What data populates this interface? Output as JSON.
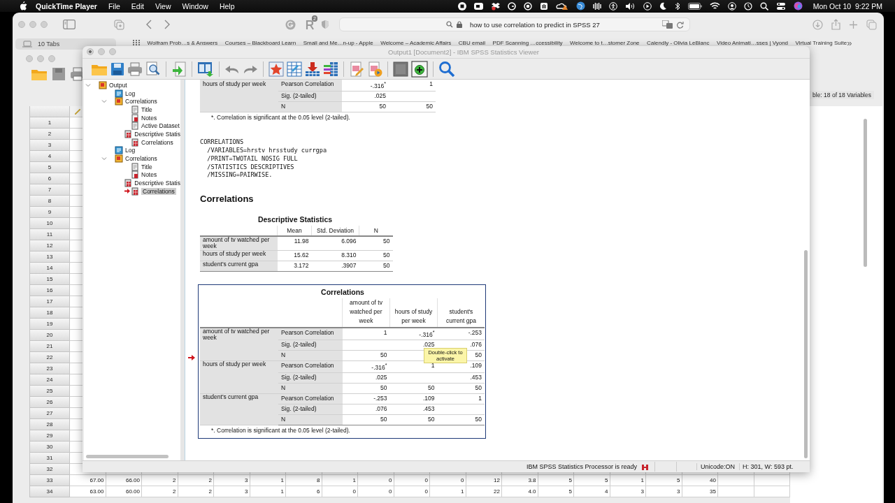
{
  "menubar": {
    "app": "QuickTime Player",
    "menus": [
      "File",
      "Edit",
      "View",
      "Window",
      "Help"
    ],
    "clock": "Mon Oct 10  9:22 PM"
  },
  "browser": {
    "tab_count": "10 Tabs",
    "extension_badge": "2",
    "address": "how to use correlation to predict in SPSS 27",
    "bookmarks": [
      "Wolfram Prob…s & Answers",
      "Courses – Blackboard Learn",
      "Small and Me…n-up - Apple",
      "Welcome – Academic Affairs",
      "CBU email",
      "PDF Scanning …ccessibility",
      "Welcome to t…stomer Zone",
      "Calendly - Olivia LeBlanc",
      "Video Animati…sses | Vyond",
      "Virtual Training Suite"
    ],
    "more": "»"
  },
  "data_editor": {
    "variables_info": "ble: 18 of 18 Variables",
    "row_numbers": [
      "1",
      "2",
      "3",
      "4",
      "5",
      "6",
      "7",
      "8",
      "9",
      "10",
      "11",
      "12",
      "13",
      "14",
      "15",
      "16",
      "17",
      "18",
      "19",
      "20",
      "21",
      "22",
      "23",
      "24",
      "25",
      "26",
      "27",
      "28",
      "29",
      "30",
      "31",
      "32"
    ],
    "data_rows": [
      {
        "number": "33",
        "cells": [
          "67.00",
          "66.00",
          "2",
          "2",
          "3",
          "1",
          "8",
          "1",
          "0",
          "0",
          "0",
          "12",
          "3.8",
          "5",
          "5",
          "1",
          "5",
          "40"
        ]
      },
      {
        "number": "34",
        "cells": [
          "63.00",
          "60.00",
          "2",
          "2",
          "3",
          "1",
          "6",
          "0",
          "0",
          "0",
          "1",
          "22",
          "4.0",
          "5",
          "4",
          "3",
          "3",
          "35"
        ]
      }
    ]
  },
  "viewer": {
    "title": "Output1 [Document2] - IBM SPSS Statistics Viewer",
    "outline": [
      {
        "label": "Output",
        "kind": "root",
        "expanded": true,
        "selected": false,
        "children": [
          {
            "label": "Log",
            "kind": "log",
            "selected": false
          },
          {
            "label": "Correlations",
            "kind": "heading",
            "expanded": true,
            "selected": false,
            "children": [
              {
                "label": "Title",
                "kind": "title",
                "selected": false
              },
              {
                "label": "Notes",
                "kind": "notes",
                "selected": false
              },
              {
                "label": "Active Dataset",
                "kind": "title",
                "selected": false
              },
              {
                "label": "Descriptive Statis",
                "kind": "table",
                "selected": false
              },
              {
                "label": "Correlations",
                "kind": "table",
                "selected": false
              }
            ]
          },
          {
            "label": "Log",
            "kind": "log",
            "selected": false
          },
          {
            "label": "Correlations",
            "kind": "heading",
            "expanded": true,
            "selected": false,
            "children": [
              {
                "label": "Title",
                "kind": "title",
                "selected": false
              },
              {
                "label": "Notes",
                "kind": "notes",
                "selected": false
              },
              {
                "label": "Descriptive Statis",
                "kind": "table",
                "selected": false
              },
              {
                "label": "Correlations",
                "kind": "table",
                "selected": true
              }
            ]
          }
        ]
      }
    ],
    "previous_table": {
      "group_label": "hours of study per week",
      "rows": [
        {
          "stat": "Pearson Correlation",
          "c1": "-.316$^{*}$",
          "c2": "1"
        },
        {
          "stat": "Sig. (2-tailed)",
          "c1": ".025"
        },
        {
          "stat": "N",
          "c1": "50",
          "c2": "50"
        }
      ],
      "footnote": "*. Correlation is significant at the 0.05 level (2-tailed)."
    },
    "syntax": [
      "CORRELATIONS",
      "  /VARIABLES=hrstv hrsstudy currgpa",
      "  /PRINT=TWOTAIL NOSIG FULL",
      "  /STATISTICS DESCRIPTIVES",
      "  /MISSING=PAIRWISE."
    ],
    "heading": "Correlations",
    "descriptives": {
      "title": "Descriptive Statistics",
      "columns": [
        "Mean",
        "Std. Deviation",
        "N"
      ],
      "rows": [
        {
          "label": "amount of tv watched per week",
          "values": [
            "11.98",
            "6.096",
            "50"
          ]
        },
        {
          "label": "hours of study per week",
          "values": [
            "15.62",
            "8.310",
            "50"
          ]
        },
        {
          "label": "student's current gpa",
          "values": [
            "3.172",
            ".3907",
            "50"
          ]
        }
      ]
    },
    "correlations": {
      "title": "Correlations",
      "selected": true,
      "columns": [
        "amount of tv watched per week",
        "hours of study per week",
        "student's current gpa"
      ],
      "groups": [
        {
          "label": "amount of tv watched per week",
          "rows": [
            {
              "stat": "Pearson Correlation",
              "c1": "1",
              "c2": "-.316$^{*}$",
              "c3": "-.253"
            },
            {
              "stat": "Sig. (2-tailed)",
              "c2": ".025",
              "c3": ".076"
            },
            {
              "stat": "N",
              "c1": "50",
              "c3": "50"
            }
          ]
        },
        {
          "label": "hours of study per week",
          "rows": [
            {
              "stat": "Pearson Correlation",
              "c1": "-.316$^{*}$",
              "c2": "1",
              "c3": ".109"
            },
            {
              "stat": "Sig. (2-tailed)",
              "c1": ".025",
              "c3": ".453"
            },
            {
              "stat": "N",
              "c1": "50",
              "c2": "50",
              "c3": "50"
            }
          ]
        },
        {
          "label": "student's current gpa",
          "rows": [
            {
              "stat": "Pearson Correlation",
              "c1": "-.253",
              "c2": ".109",
              "c3": "1"
            },
            {
              "stat": "Sig. (2-tailed)",
              "c1": ".076",
              "c2": ".453"
            },
            {
              "stat": "N",
              "c1": "50",
              "c2": "50",
              "c3": "50"
            }
          ]
        }
      ],
      "footnote": "*. Correlation is significant at the 0.05 level (2-tailed).",
      "tooltip": "Double-click to activate"
    },
    "status": {
      "message": "IBM SPSS Statistics Processor is ready",
      "encoding": "Unicode:ON",
      "size": "H: 301, W: 593 pt."
    }
  }
}
